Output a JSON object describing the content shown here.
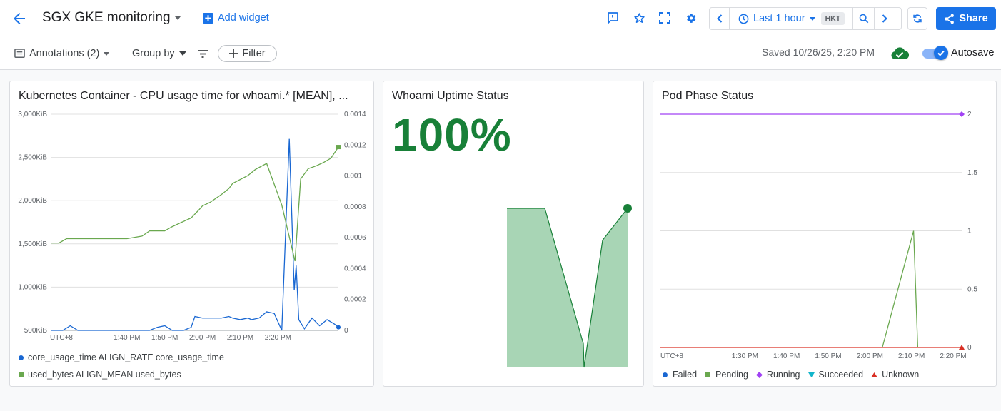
{
  "header": {
    "title": "SGX GKE monitoring",
    "add_widget": "Add widget",
    "time_range": "Last 1 hour",
    "timezone": "HKT",
    "share": "Share"
  },
  "toolbar": {
    "annotations": "Annotations (2)",
    "group_by": "Group by",
    "filter": "Filter",
    "saved": "Saved 10/26/25, 2:20 PM",
    "autosave": "Autosave"
  },
  "colors": {
    "accent": "#1a73e8",
    "green": "#188038",
    "series_blue": "#1967d2",
    "series_green": "#6aa84f",
    "purple": "#a142f4",
    "red": "#d93025",
    "teal": "#12b5cb"
  },
  "widgets": {
    "cpu": {
      "title": "Kubernetes Container - CPU usage time for whoami.* [MEAN], ...",
      "legend": [
        {
          "name": "core_usage_time ALIGN_RATE core_usage_time",
          "color": "#1967d2",
          "shape": "circle"
        },
        {
          "name": "used_bytes ALIGN_MEAN used_bytes",
          "color": "#6aa84f",
          "shape": "square"
        }
      ]
    },
    "uptime": {
      "title": "Whoami Uptime Status",
      "value": "100%"
    },
    "pod": {
      "title": "Pod Phase Status",
      "legend": [
        {
          "name": "Failed",
          "color": "#1967d2",
          "shape": "circle"
        },
        {
          "name": "Pending",
          "color": "#6aa84f",
          "shape": "square"
        },
        {
          "name": "Running",
          "color": "#a142f4",
          "shape": "diamond"
        },
        {
          "name": "Succeeded",
          "color": "#12b5cb",
          "shape": "triangle-down"
        },
        {
          "name": "Unknown",
          "color": "#d93025",
          "shape": "triangle-up"
        }
      ]
    }
  },
  "chart_data": [
    {
      "type": "line",
      "title": "Kubernetes Container - CPU usage time for whoami.* [MEAN], ...",
      "x_ticks": [
        "UTC+8",
        "1:40 PM",
        "1:50 PM",
        "2:00 PM",
        "2:10 PM",
        "2:20 PM"
      ],
      "y_left_ticks": [
        "500KiB",
        "1,000KiB",
        "1,500KiB",
        "2,000KiB",
        "2,500KiB",
        "3,000KiB"
      ],
      "y_left_values": [
        500,
        1000,
        1500,
        2000,
        2500,
        3000
      ],
      "y_right_ticks": [
        "0",
        "0.0002",
        "0.0004",
        "0.0006",
        "0.0008",
        "0.001",
        "0.0012",
        "0.0014"
      ],
      "y_right_values": [
        0,
        0.0002,
        0.0004,
        0.0006,
        0.0008,
        0.001,
        0.0012,
        0.0014
      ],
      "x_unit": "minutes after 1:20 PM",
      "xlim": [
        0,
        63
      ],
      "ylim_left": [
        500,
        3000
      ],
      "ylim_right": [
        0,
        0.0014
      ],
      "series": [
        {
          "name": "core_usage_time ALIGN_RATE core_usage_time",
          "axis": "right",
          "color": "#1967d2",
          "points": [
            [
              0,
              0
            ],
            [
              3,
              0
            ],
            [
              5,
              3e-05
            ],
            [
              7,
              0
            ],
            [
              12,
              0
            ],
            [
              17,
              0
            ],
            [
              22,
              0
            ],
            [
              26,
              0
            ],
            [
              28,
              2e-05
            ],
            [
              30,
              3e-05
            ],
            [
              32,
              0
            ],
            [
              35,
              0
            ],
            [
              37,
              2e-05
            ],
            [
              38,
              9e-05
            ],
            [
              40,
              8e-05
            ],
            [
              43,
              8e-05
            ],
            [
              45,
              8e-05
            ],
            [
              47,
              9e-05
            ],
            [
              48,
              8e-05
            ],
            [
              50,
              7e-05
            ],
            [
              52,
              8e-05
            ],
            [
              53,
              7e-05
            ],
            [
              55,
              8e-05
            ],
            [
              57,
              0.00012
            ],
            [
              59,
              0.00011
            ],
            [
              61,
              0
            ],
            [
              63,
              0.00124
            ],
            [
              64.3,
              0.00026
            ],
            [
              64.8,
              0.00042
            ],
            [
              65.5,
              7e-05
            ],
            [
              67,
              1e-05
            ],
            [
              69,
              8e-05
            ],
            [
              71,
              3e-05
            ],
            [
              73,
              7e-05
            ],
            [
              75,
              4e-05
            ],
            [
              76,
              2e-05
            ]
          ]
        },
        {
          "name": "used_bytes ALIGN_MEAN used_bytes",
          "axis": "left",
          "color": "#6aa84f",
          "points": [
            [
              0,
              1510
            ],
            [
              2,
              1510
            ],
            [
              4,
              1560
            ],
            [
              20,
              1560
            ],
            [
              24,
              1590
            ],
            [
              26,
              1650
            ],
            [
              30,
              1650
            ],
            [
              32,
              1700
            ],
            [
              35,
              1760
            ],
            [
              37,
              1800
            ],
            [
              39,
              1890
            ],
            [
              40,
              1940
            ],
            [
              42,
              1980
            ],
            [
              45,
              2070
            ],
            [
              47,
              2140
            ],
            [
              48,
              2200
            ],
            [
              52,
              2290
            ],
            [
              54,
              2360
            ],
            [
              57,
              2430
            ],
            [
              61,
              1950
            ],
            [
              64.5,
              1300
            ],
            [
              66,
              2250
            ],
            [
              68,
              2370
            ],
            [
              70,
              2400
            ],
            [
              72,
              2440
            ],
            [
              74,
              2490
            ],
            [
              76,
              2620
            ]
          ]
        }
      ],
      "x_axis_note": "x values in minutes after 1:20 PM"
    },
    {
      "type": "area",
      "title": "Whoami Uptime Status",
      "x_unit": "sample index",
      "series": [
        {
          "name": "",
          "color": "#188038",
          "points": [
            [
              0,
              1
            ],
            [
              1,
              1
            ],
            [
              2,
              0.15
            ],
            [
              3,
              0
            ],
            [
              4,
              0.8
            ],
            [
              5,
              1
            ]
          ]
        }
      ],
      "ylim": [
        0,
        1
      ]
    },
    {
      "type": "line",
      "title": "Pod Phase Status",
      "x_ticks": [
        "UTC+8",
        "1:30 PM",
        "1:40 PM",
        "1:50 PM",
        "2:00 PM",
        "2:10 PM",
        "2:20 PM"
      ],
      "y_ticks": [
        "0",
        "0.5",
        "1",
        "1.5",
        "2"
      ],
      "y_values": [
        0,
        0.5,
        1,
        1.5,
        2
      ],
      "x_unit": "minutes after 1:20 PM",
      "ylim": [
        0,
        2
      ],
      "series": [
        {
          "name": "Running",
          "color": "#a142f4",
          "points": [
            [
              0,
              2
            ],
            [
              63,
              2
            ]
          ]
        },
        {
          "name": "Unknown",
          "color": "#d93025",
          "points": [
            [
              0,
              0
            ],
            [
              63,
              0
            ]
          ]
        },
        {
          "name": "Pending",
          "color": "#6aa84f",
          "points": [
            [
              43,
              0
            ],
            [
              50.5,
              1
            ],
            [
              51.5,
              0
            ]
          ]
        }
      ],
      "x_axis_note": "x values in minutes after 1:20 PM"
    }
  ]
}
